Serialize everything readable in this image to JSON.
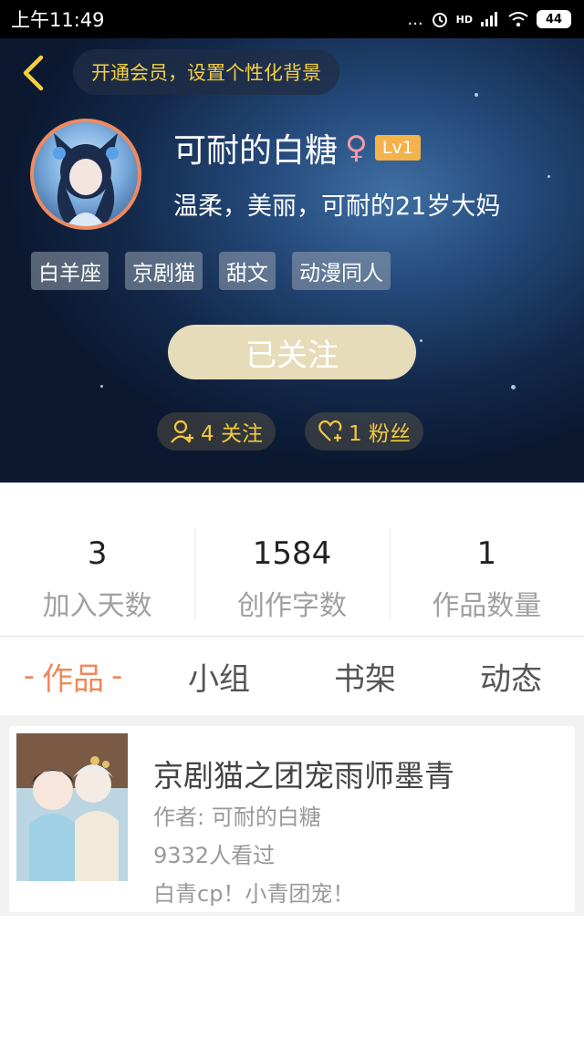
{
  "status_bar": {
    "time": "上午11:49",
    "dots": "...",
    "network": "HD",
    "battery": "44"
  },
  "header": {
    "vip_prompt": "开通会员，设置个性化背景",
    "nickname": "可耐的白糖",
    "gender_symbol": "♀",
    "level": "Lv1",
    "bio": "温柔，美丽，可耐的21岁大妈",
    "tags": [
      "白羊座",
      "京剧猫",
      "甜文",
      "动漫同人"
    ],
    "follow_button": "已关注",
    "following": "4 关注",
    "fans": "1 粉丝",
    "accent_color": "#f4c93a"
  },
  "stats": [
    {
      "value": "3",
      "label": "加入天数"
    },
    {
      "value": "1584",
      "label": "创作字数"
    },
    {
      "value": "1",
      "label": "作品数量"
    }
  ],
  "tabs": {
    "active_dash": "-",
    "items": [
      "作品",
      "小组",
      "书架",
      "动态"
    ],
    "active_index": 0,
    "active_color": "#f0885a"
  },
  "works": [
    {
      "title": "京剧猫之团宠雨师墨青",
      "author": "作者: 可耐的白糖",
      "views": "9332人看过",
      "desc": "白青cp！小青团宠！"
    }
  ]
}
